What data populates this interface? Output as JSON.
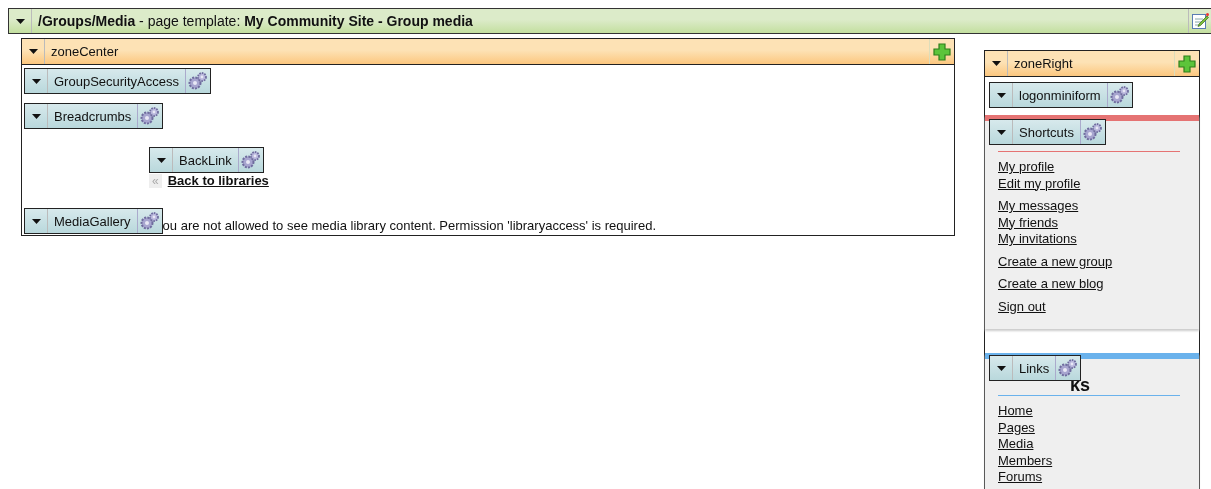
{
  "page_template": {
    "path": "/Groups/Media",
    "label": "- page template:",
    "name": "My Community Site - Group media"
  },
  "zone_center": {
    "title": "zoneCenter",
    "web_parts": [
      {
        "name": "GroupSecurityAccess"
      },
      {
        "name": "Breadcrumbs"
      },
      {
        "name": "BackLink"
      },
      {
        "name": "MediaGallery"
      }
    ],
    "back_link": "Back to libraries",
    "back_icon": "«",
    "message": "ou are not allowed to see media library content. Permission 'libraryaccess' is required."
  },
  "zone_right": {
    "title": "zoneRight",
    "web_parts": [
      {
        "name": "logonminiform"
      },
      {
        "name": "Shortcuts"
      },
      {
        "name": "Links"
      }
    ],
    "shortcuts": {
      "groups": [
        [
          "My profile",
          "Edit my profile"
        ],
        [
          "My messages",
          "My friends",
          "My invitations"
        ],
        [
          "Create a new group"
        ],
        [
          "Create a new blog"
        ],
        [
          "Sign out"
        ]
      ]
    },
    "group_links": {
      "heading_fragment": "ks",
      "links": [
        "Home",
        "Pages",
        "Media",
        "Members",
        "Forums"
      ]
    }
  }
}
